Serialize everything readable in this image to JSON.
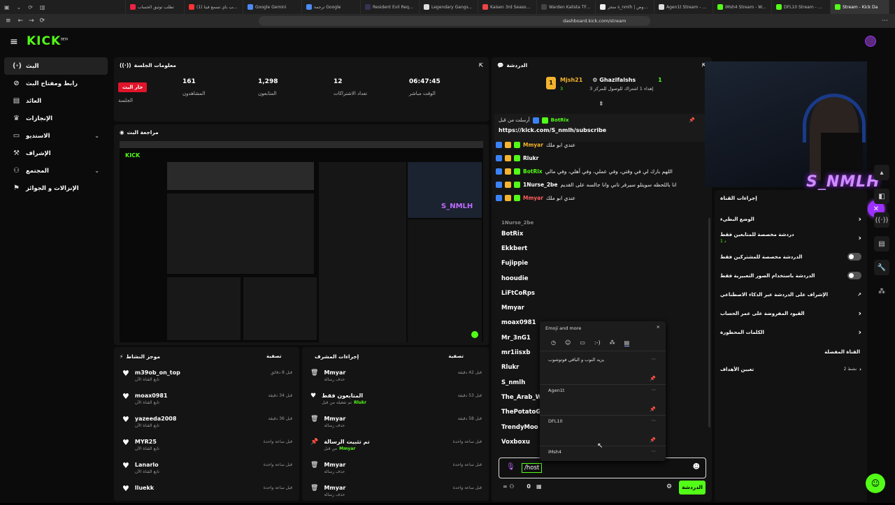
{
  "browser": {
    "tabs": [
      {
        "label": "تطلب توثيق الحساب",
        "color": "#e24"
      },
      {
        "label": "(1) مرحب بأي تسمع فينا",
        "color": "#f33"
      },
      {
        "label": "Google Gemini",
        "color": "#4b8bf5"
      },
      {
        "label": "ترجمة Google",
        "color": "#4b8bf5"
      },
      {
        "label": "Resident Evil Requiem",
        "color": "#335"
      },
      {
        "label": "Legendary Gangsta Rap",
        "color": "#ddd"
      },
      {
        "label": "Kaisen 3rd Season انمي",
        "color": "#e44"
      },
      {
        "label": "Warden Kalista TFT Com",
        "color": "#444"
      },
      {
        "label": "متجر s_nmlh | أفضل عروض",
        "color": "#eee"
      },
      {
        "label": "Agen1t Stream - Watch",
        "color": "#ddd"
      },
      {
        "label": "iMsh4 Stream - Watch L",
        "color": "#53fc18"
      },
      {
        "label": "DFL10 Stream - Watch L",
        "color": "#53fc18"
      },
      {
        "label": "Stream - Kick Da",
        "color": "#53fc18"
      }
    ],
    "url": "dashboard.kick.com/stream"
  },
  "logo": "KICK",
  "logo_beta": "BETA",
  "nav": [
    {
      "label": "البث",
      "icon": "(·)",
      "active": true
    },
    {
      "label": "رابط ومفتاح البث",
      "icon": "⊘"
    },
    {
      "label": "العائد",
      "icon": "▤"
    },
    {
      "label": "الإنجازات",
      "icon": "♛"
    },
    {
      "label": "الاستديو",
      "icon": "▭",
      "expand": true
    },
    {
      "label": "الإشراف",
      "icon": "⚒"
    },
    {
      "label": "المجتمع",
      "icon": "⚇",
      "expand": true
    },
    {
      "label": "الإنزالات و الجوائز",
      "icon": "⚑"
    }
  ],
  "session": {
    "title": "معلومات الجلسة",
    "live_badge": "جار البث",
    "session_label": "الجلسة",
    "stats": [
      {
        "value": "161",
        "label": "المشاهدون"
      },
      {
        "value": "1,298",
        "label": "المتابعون"
      },
      {
        "value": "12",
        "label": "تعداد الاشتراكات"
      },
      {
        "value": "06:47:45",
        "label": "الوقت مباشر"
      }
    ]
  },
  "preview": {
    "title": "مراجعة البث"
  },
  "activity": {
    "title": "موجز النشاط",
    "filter": "تصفية",
    "items": [
      {
        "name": "m39ob_on_top",
        "sub": "تابع القناة الآن",
        "time": "قبل 8 دقائق"
      },
      {
        "name": "moax0981",
        "sub": "تابع القناة الآن",
        "time": "قبل 34 دقيقة"
      },
      {
        "name": "yazeeda2008",
        "sub": "تابع القناة الآن",
        "time": "قبل 36 دقيقة"
      },
      {
        "name": "MYR25",
        "sub": "تابع القناة الآن",
        "time": "قبل ساعة واحدة"
      },
      {
        "name": "Lanarlo",
        "sub": "تابع القناة الآن",
        "time": "قبل ساعة واحدة"
      },
      {
        "name": "lluekk",
        "sub": "",
        "time": "قبل ساعة واحدة"
      }
    ]
  },
  "modactions": {
    "title": "إجراءات المشرف",
    "filter": "تصفية",
    "items": [
      {
        "name": "Mmyar",
        "sub": "حذف رسالة",
        "time": "قبل 42 دقيقة",
        "icon": "🗑"
      },
      {
        "name": "المتابعون فقط",
        "sub": "تم تفعيله من قبل",
        "by": "Rlukr",
        "time": "قبل 53 دقيقة",
        "icon": "♥"
      },
      {
        "name": "Mmyar",
        "sub": "حذف رسالة",
        "time": "قبل 58 دقيقة",
        "icon": "🗑"
      },
      {
        "name": "تم تثبيت الرسالة",
        "sub": "من قبل",
        "by": "Mmyar",
        "time": "قبل ساعة واحدة",
        "icon": "📌"
      },
      {
        "name": "Mmyar",
        "sub": "حذف رسالة",
        "time": "قبل ساعة واحدة",
        "icon": "🗑"
      },
      {
        "name": "Mmyar",
        "sub": "حذف رسالة",
        "time": "قبل ساعة واحدة",
        "icon": "🗑"
      }
    ]
  },
  "chat": {
    "title": "الدردشة",
    "top_gifter": "Mjsh21",
    "top_count": "3",
    "goal_user": "Ghazifalshs",
    "goal_count": "1",
    "goal_text": "إهداء 1 اشتراك للوصول للمركز 3",
    "pinned_by": "أرسلت من قبل",
    "pinned_user": "BotRix",
    "pinned_link": "https://kick.com/S_nmlh/subscribe",
    "messages": [
      {
        "user": "Mmyar",
        "text": "عندي ابو ملك",
        "color": "#f3b42d"
      },
      {
        "user": "Rlukr",
        "text": "",
        "color": "#fff"
      },
      {
        "user": "BotRix",
        "text": "اللهم بارك لي في وقتي، وفي عملي، وفي أهلي، وفي مالي",
        "color": "#53fc18"
      },
      {
        "user": "1Nurse_2be",
        "text": "انا باللحظه سويتلو سيرفر تاني وانا جالسه على القديم",
        "color": "#fff"
      },
      {
        "user": "Mmyar",
        "text": "عندي ابو ملك",
        "color": "#ff5c5c"
      }
    ],
    "users": [
      "1Nurse_2be",
      "BotRix",
      "Ekkbert",
      "Fujippie",
      "hooudie",
      "LiFtCoRps",
      "Mmyar",
      "moax0981",
      "Mr_3nG1",
      "mr1iisxb",
      "Rlukr",
      "S_nmlh",
      "The_Arab_Wo",
      "ThePotatoGo",
      "TrendyMoo",
      "Voxboxu"
    ],
    "input_value": "/host",
    "send_label": "الدردشة",
    "count": "0"
  },
  "emoji": {
    "title": "Emoji and more",
    "cards": [
      "يزيد النوب و الباقي فوتوشوب",
      "Agen1t",
      "DFL10",
      "iMsh4"
    ]
  },
  "overlay_name": "S_NMLH",
  "settings": {
    "title": "إجراءات القناة",
    "rows": [
      {
        "label": "الوضع البطيء",
        "kind": "chev"
      },
      {
        "label": "دردشة مخصصة للمتابعين فقط",
        "sub": "1 د",
        "kind": "chev"
      },
      {
        "label": "الدردشة مخصصة للمشتركين فقط",
        "kind": "toggle"
      },
      {
        "label": "الدردشة باستخدام الصور التعبيرية فقط",
        "kind": "toggle"
      },
      {
        "label": "الإشراف على الدردشة عبر الذكاء الاصطناعي",
        "kind": "ext"
      },
      {
        "label": "القيود المفروضة على عمر الحساب",
        "kind": "chev"
      },
      {
        "label": "الكلمات المحظورة",
        "kind": "chev"
      }
    ],
    "section": "القناة المفضلة",
    "goals_label": "تعيين الأهداف",
    "goals_status": "نشط 2"
  }
}
